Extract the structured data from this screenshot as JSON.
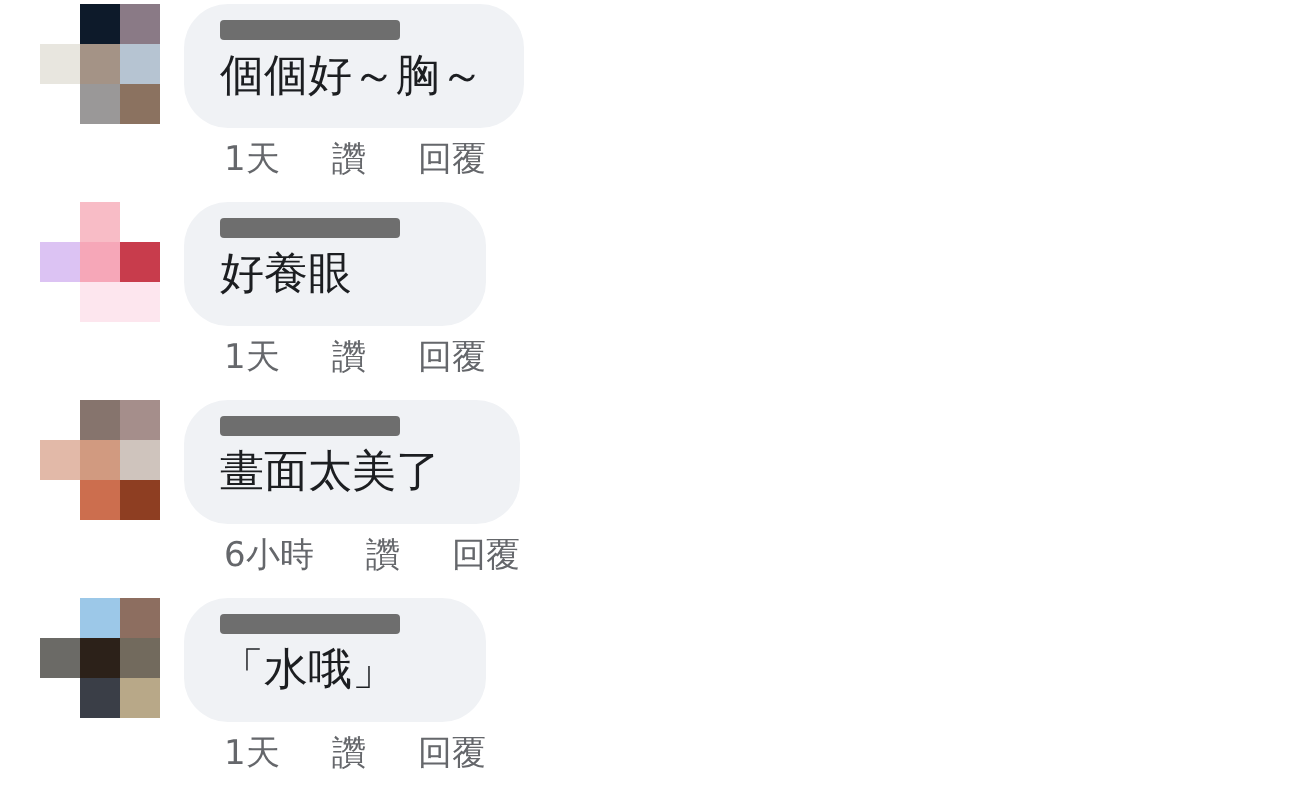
{
  "comments": [
    {
      "text": "個個好～胸～",
      "time": "1天",
      "like": "讚",
      "reply": "回覆"
    },
    {
      "text": "好養眼",
      "time": "1天",
      "like": "讚",
      "reply": "回覆"
    },
    {
      "text": "畫面太美了",
      "time": "6小時",
      "like": "讚",
      "reply": "回覆"
    },
    {
      "text": "「水哦」",
      "time": "1天",
      "like": "讚",
      "reply": "回覆"
    }
  ]
}
